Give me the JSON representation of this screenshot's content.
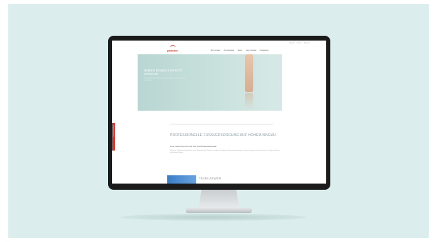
{
  "colors": {
    "background": "#dbeeed",
    "bezel": "#1b1b1b",
    "brand_red": "#d53a2e",
    "hero_teal": "#bcd8d4",
    "accent_blue": "#3a7ec8"
  },
  "site": {
    "logo_text": "pedcare",
    "utility_links": [
      "Kontakt",
      "Suche",
      "Sprache"
    ],
    "nav_items": [
      "Über Pedcare",
      "Wunschdesign",
      "Spezie",
      "Neue Produkte",
      "Haufigkeiten"
    ],
    "hero": {
      "title": "IMMER EINEN SCHRITT VORAUS",
      "subtitle": "Maßgeschneiderte Einlagen und orthopädische Versorgung aus einer Hand."
    },
    "side_tab_label": "Termin vereinbaren",
    "section": {
      "title": "PROFESSIONELLE FUSSVERSORGUNG AUF HOHEM NIVEAU",
      "subtitle": "FULL-SERVICE FÜR IHR ORTHOPÄDIEHANDWERK",
      "paragraph": "Wir bieten Orthopädieschuhtechnikern und Sanitätshäusern Zugang zu moderner Fertigung und Versorgungskonzepten. Unsere Lösungen vereinen Handwerk, Technik und Service auf höchstem Niveau."
    },
    "team_label": "TEAM VIEWER"
  }
}
